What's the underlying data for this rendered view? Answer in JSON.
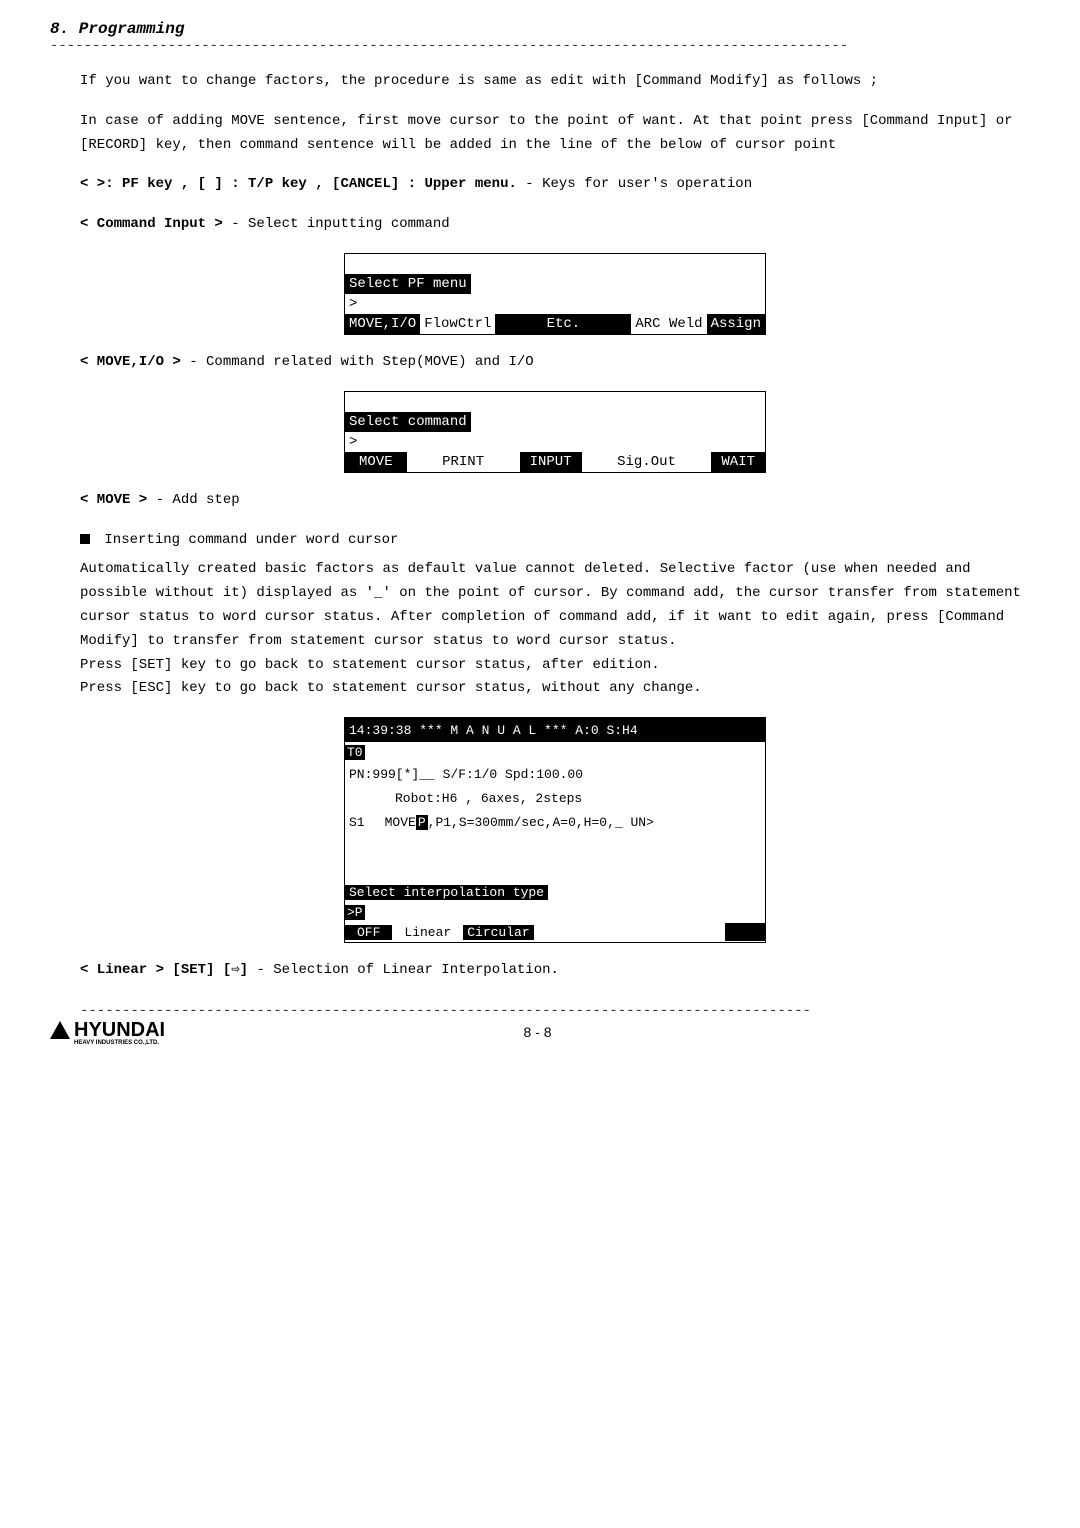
{
  "header": {
    "title": "8. Programming"
  },
  "p1": "If you want to change factors, the procedure is same as edit with [Command Modify] as follows ;",
  "p2": "In case of adding MOVE sentence, first move cursor to the point of want. At that point press [Command Input] or [RECORD] key, then command sentence will be added in the line of the below of cursor point",
  "line_pf": {
    "prefix": "< >: PF key , [  ] : T/P key , [CANCEL] : Upper menu.",
    "suffix": "  - Keys for user's operation"
  },
  "line_cmdinput": {
    "prefix": "< Command Input >",
    "suffix": " - Select inputting command"
  },
  "menu1": {
    "title": "Select PF menu",
    "prompt": ">",
    "c1": "MOVE,I/O",
    "c2": "FlowCtrl",
    "c3": "Etc.",
    "c4": "ARC Weld",
    "c5": "Assign"
  },
  "line_moveio": {
    "prefix": "< MOVE,I/O >",
    "suffix": " - Command related with Step(MOVE) and I/O"
  },
  "menu2": {
    "title": "Select command",
    "prompt": ">",
    "c1": "MOVE",
    "c2": "PRINT",
    "c3": "INPUT",
    "c4": "Sig.Out",
    "c5": "WAIT"
  },
  "line_move": {
    "prefix": "< MOVE >",
    "suffix": " - Add step"
  },
  "bullet_title": "Inserting command under word cursor",
  "p3": "Automatically created basic factors as default value cannot deleted. Selective factor (use when needed and possible without it) displayed as '_' on the point of cursor. By command add, the cursor transfer from statement cursor status to word cursor status. After completion of command add, if it want to edit again, press [Command Modify] to transfer from statement cursor status to word cursor status.",
  "p4": "Press [SET] key to go back to statement cursor status, after edition.",
  "p5": "Press [ESC] key to go back to statement cursor status, without any change.",
  "screen": {
    "top": "14:39:38  ***  M A N U A L *** A:0 S:H4",
    "t0": "T0",
    "pn": "PN:999[*]__ S/F:1/0  Spd:100.00",
    "robot": "Robot:H6    , 6axes, 2steps",
    "s1_label": "S1",
    "s1_pre": "MOVE ",
    "s1_cursor": "P",
    "s1_post": ",P1,S=300mm/sec,A=0,H=0,_ UN>",
    "sel_title": "Select interpolation type",
    "sel_prompt": ">P",
    "f1": "OFF",
    "f2": "Linear",
    "f3": "Circular"
  },
  "line_linear": {
    "prefix": "< Linear > [SET] [⇨]",
    "suffix": " - Selection of Linear Interpolation."
  },
  "footer": {
    "brand": "HYUNDAI",
    "sub": "HEAVY INDUSTRIES CO.,LTD.",
    "page": "8 - 8"
  }
}
